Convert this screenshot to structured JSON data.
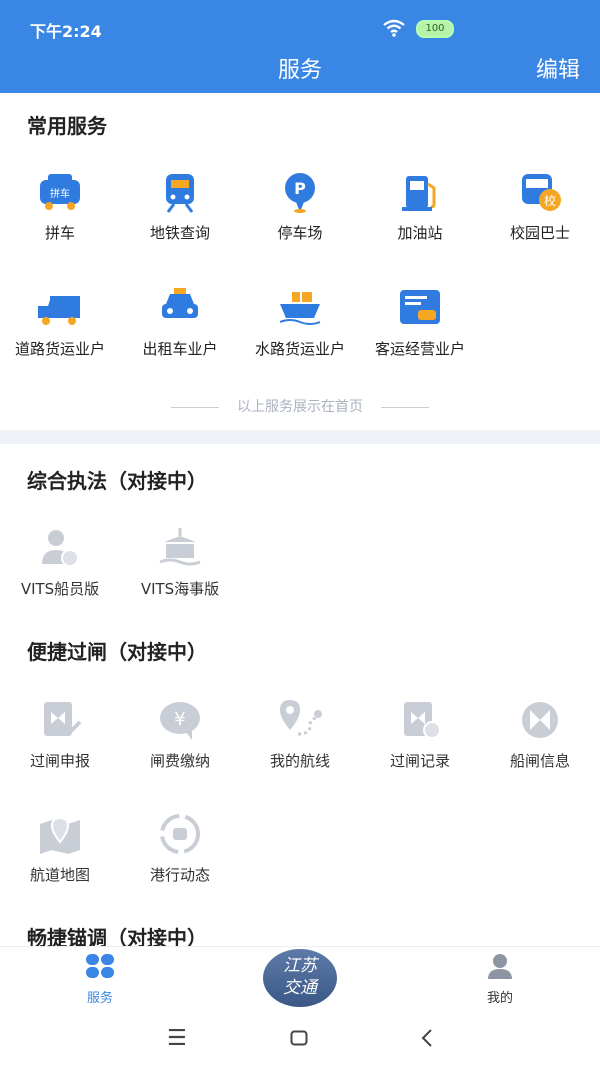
{
  "status_bar": {
    "time": "下午2:24",
    "battery": "100"
  },
  "header": {
    "title": "服务",
    "edit": "编辑"
  },
  "common": {
    "title": "常用服务",
    "items": [
      {
        "label": "拼车",
        "icon": "carpool-icon"
      },
      {
        "label": "地铁查询",
        "icon": "subway-icon"
      },
      {
        "label": "停车场",
        "icon": "parking-icon"
      },
      {
        "label": "加油站",
        "icon": "gas-station-icon"
      },
      {
        "label": "校园巴士",
        "icon": "school-bus-icon"
      },
      {
        "label": "道路货运业户",
        "icon": "truck-icon"
      },
      {
        "label": "出租车业户",
        "icon": "taxi-icon"
      },
      {
        "label": "水路货运业户",
        "icon": "cargo-ship-icon"
      },
      {
        "label": "客运经营业户",
        "icon": "bus-card-icon"
      }
    ],
    "footer_note": "以上服务展示在首页"
  },
  "enforcement": {
    "title": "综合执法（对接中）",
    "items": [
      {
        "label": "VITS船员版",
        "icon": "crew-icon"
      },
      {
        "label": "VITS海事版",
        "icon": "maritime-icon"
      }
    ]
  },
  "lock": {
    "title": "便捷过闸（对接中）",
    "items": [
      {
        "label": "过闸申报",
        "icon": "lock-report-icon"
      },
      {
        "label": "闸费缴纳",
        "icon": "fee-payment-icon"
      },
      {
        "label": "我的航线",
        "icon": "route-icon"
      },
      {
        "label": "过闸记录",
        "icon": "lock-record-icon"
      },
      {
        "label": "船闸信息",
        "icon": "lock-info-icon"
      },
      {
        "label": "航道地图",
        "icon": "channel-map-icon"
      },
      {
        "label": "港行动态",
        "icon": "port-dynamic-icon"
      }
    ]
  },
  "anchor": {
    "title": "畅捷锚调（对接中）"
  },
  "bottom_nav": {
    "service": "服务",
    "center_line1": "江苏",
    "center_line2": "交通",
    "mine": "我的"
  },
  "colors": {
    "primary": "#3a86e4",
    "icon_blue": "#2f7be0",
    "icon_orange": "#f5a623",
    "icon_gray": "#c9ced6"
  }
}
